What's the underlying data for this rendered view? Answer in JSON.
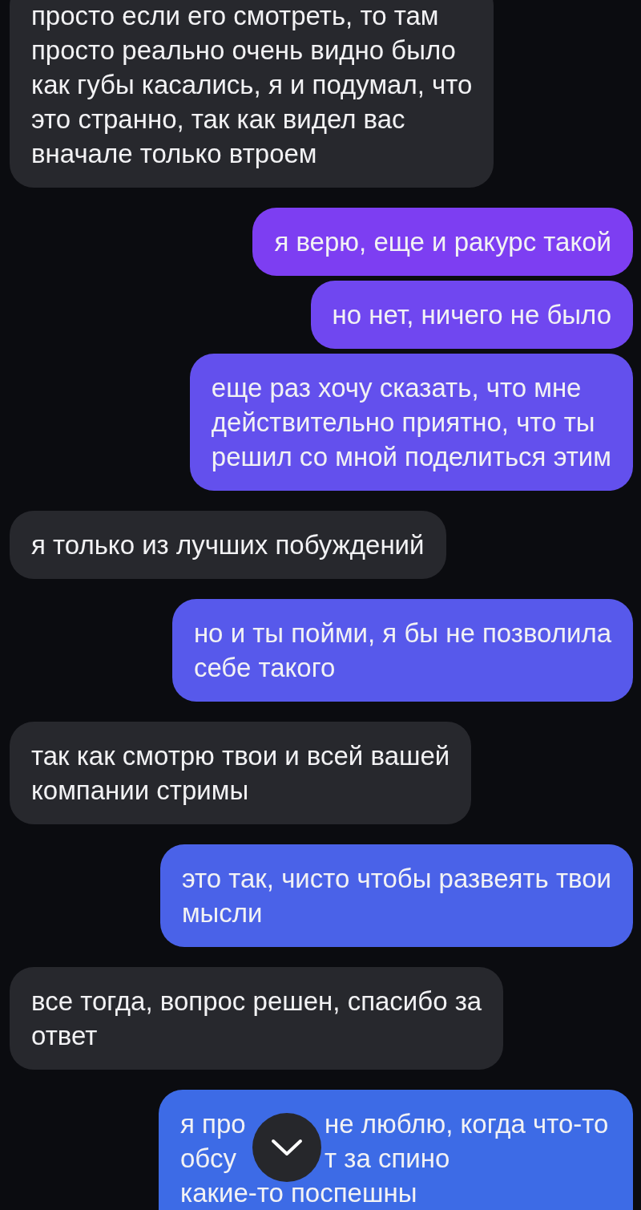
{
  "messages": [
    {
      "kind": "incoming",
      "lines": [
        [
          "просто если его смотреть, то там"
        ],
        [
          "просто реально очень видно было"
        ],
        [
          "как губы касались, я и подумал, что"
        ],
        [
          "это странно, так как видел вас"
        ],
        [
          "вначале только втроем"
        ]
      ]
    },
    {
      "kind": "outgoing",
      "lines": [
        [
          "я верю, еще и ракурс такой"
        ]
      ]
    },
    {
      "kind": "outgoing",
      "lines": [
        [
          "но нет, ничего не было"
        ]
      ]
    },
    {
      "kind": "outgoing",
      "lines": [
        [
          "еще раз хочу сказать, что мне"
        ],
        [
          "действительно приятно, что ты"
        ],
        [
          "решил со мной поделиться этим"
        ]
      ]
    },
    {
      "kind": "incoming",
      "lines": [
        [
          "я только из лучших побуждений"
        ]
      ]
    },
    {
      "kind": "outgoing",
      "lines": [
        [
          "но и ты пойми, я бы не позволила"
        ],
        [
          "себе такого"
        ]
      ]
    },
    {
      "kind": "incoming",
      "lines": [
        [
          "так как смотрю твои и всей вашей"
        ],
        [
          "компании стримы"
        ]
      ]
    },
    {
      "kind": "outgoing",
      "lines": [
        [
          "это так, чисто чтобы развеять твои"
        ],
        [
          "мысли"
        ]
      ]
    },
    {
      "kind": "incoming",
      "lines": [
        [
          "все тогда, вопрос решен, спасибо за"
        ],
        [
          "ответ"
        ]
      ]
    },
    {
      "kind": "outgoing",
      "lines": [
        [
          "я про",
          "не люблю, когда что-то"
        ],
        [
          "обсу",
          "т за спино"
        ],
        [
          "какие-то поспешны"
        ]
      ]
    }
  ],
  "scroll_down_button": {
    "kind": "chevron"
  }
}
